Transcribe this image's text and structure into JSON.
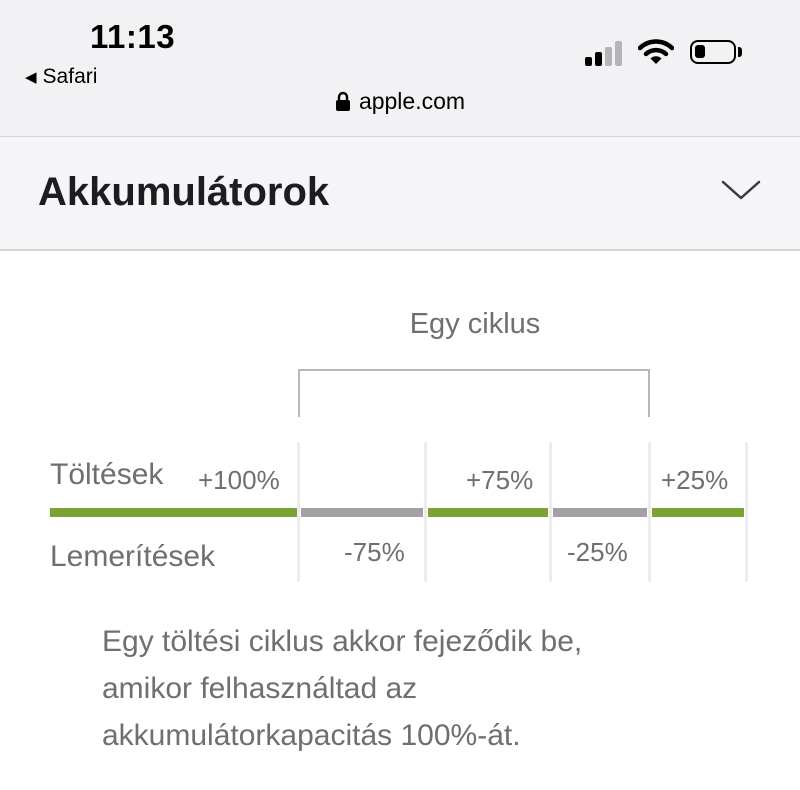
{
  "status_bar": {
    "time": "11:13",
    "back_app": "Safari",
    "url": "apple.com"
  },
  "section": {
    "title": "Akkumulátorok"
  },
  "diagram": {
    "cycle_label": "Egy ciklus",
    "row_charge_label": "Töltések",
    "row_discharge_label": "Lemerítések",
    "segments": [
      {
        "label": "+100%",
        "kind": "charge",
        "color": "#7ba232"
      },
      {
        "label": "-75%",
        "kind": "discharge",
        "color": "#a1a1a6"
      },
      {
        "label": "+75%",
        "kind": "charge",
        "color": "#7ba232"
      },
      {
        "label": "-25%",
        "kind": "discharge",
        "color": "#a1a1a6"
      },
      {
        "label": "+25%",
        "kind": "charge",
        "color": "#7ba232"
      }
    ]
  },
  "caption": {
    "line1": "Egy töltési ciklus akkor fejeződik be,",
    "line2": "amikor felhasználtad az",
    "line3": "akkumulátorkapacitás 100%-át."
  },
  "colors": {
    "charge": "#7ba232",
    "discharge": "#a1a1a6",
    "text_secondary": "#6e6e73"
  }
}
